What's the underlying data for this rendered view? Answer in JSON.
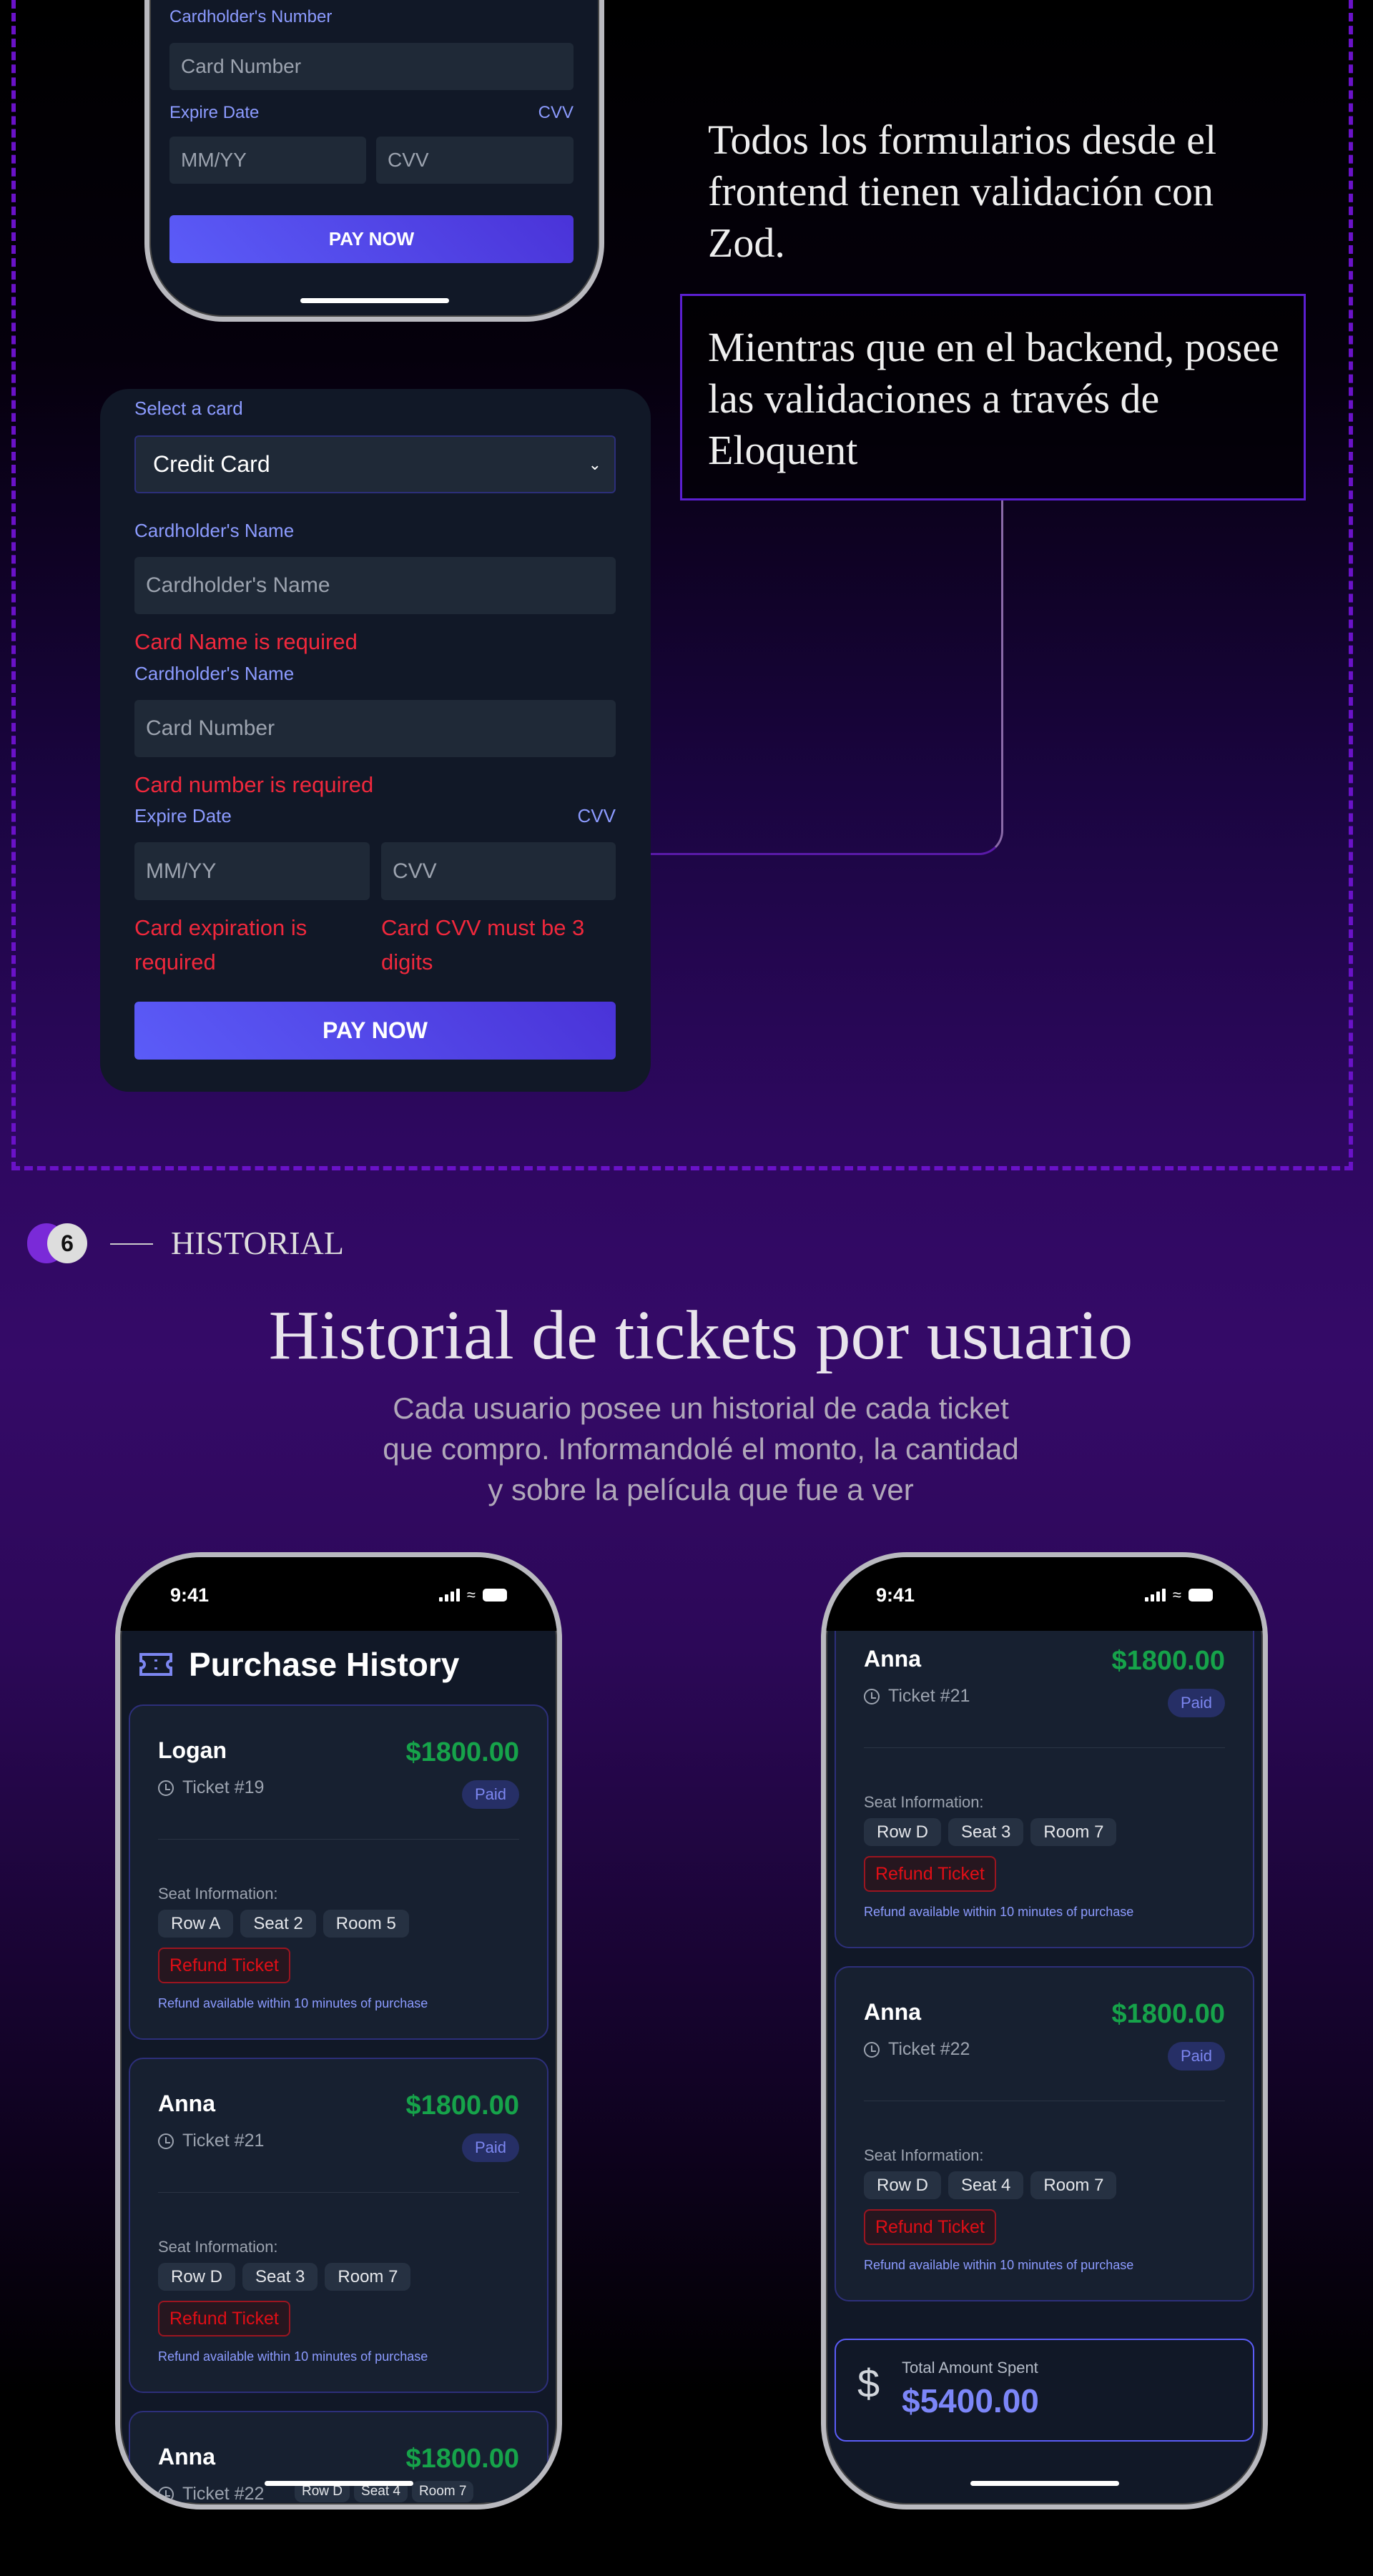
{
  "colors": {
    "accent": "#5b5cf8",
    "error": "#f0283c",
    "success": "#16a34a",
    "frame": "#6a12c8"
  },
  "top_form": {
    "card_number_label": "Cardholder's Number",
    "card_number_placeholder": "Card Number",
    "expire_label": "Expire Date",
    "cvv_label": "CVV",
    "expire_placeholder": "MM/YY",
    "cvv_placeholder": "CVV",
    "pay_label": "PAY NOW"
  },
  "notes": {
    "frontend": "Todos los formularios desde el frontend tienen validación con Zod.",
    "backend": "Mientras que en el backend, posee las validaciones a través de Eloquent"
  },
  "validation_form": {
    "select_label": "Select a card",
    "select_value": "Credit Card",
    "name_label": "Cardholder's Name",
    "name_placeholder": "Cardholder's Name",
    "name_error": "Card Name is required",
    "number_label": "Cardholder's Name",
    "number_placeholder": "Card Number",
    "number_error": "Card number is required",
    "expire_label": "Expire Date",
    "cvv_label": "CVV",
    "expire_placeholder": "MM/YY",
    "cvv_placeholder": "CVV",
    "expire_error": "Card expiration is required",
    "cvv_error": "Card CVV must be 3 digits",
    "pay_label": "PAY NOW"
  },
  "section": {
    "number": "6",
    "label": "HISTORIAL",
    "title": "Historial de tickets por usuario",
    "subtitle": [
      "Cada usuario posee un historial de cada ticket",
      "que compro. Informandolé el monto, la cantidad",
      "y sobre la película que fue a ver"
    ]
  },
  "status_bar": {
    "time": "9:41"
  },
  "history": {
    "title": "Purchase History",
    "seat_label": "Seat Information:",
    "refund_label": "Refund Ticket",
    "refund_note": "Refund available within 10 minutes of purchase",
    "status": "Paid",
    "left": [
      {
        "name": "Logan",
        "price": "$1800.00",
        "ticket": "Ticket #19",
        "seats": [
          "Row A",
          "Seat 2",
          "Room 5"
        ]
      },
      {
        "name": "Anna",
        "price": "$1800.00",
        "ticket": "Ticket #21",
        "seats": [
          "Row D",
          "Seat 3",
          "Room 7"
        ]
      },
      {
        "name": "Anna",
        "price": "$1800.00",
        "ticket": "Ticket #22",
        "seats": [
          "Row D",
          "Seat 4",
          "Room 7"
        ]
      }
    ],
    "right": [
      {
        "name": "Anna",
        "price": "$1800.00",
        "ticket": "Ticket #21",
        "seats": [
          "Row D",
          "Seat 3",
          "Room 7"
        ]
      },
      {
        "name": "Anna",
        "price": "$1800.00",
        "ticket": "Ticket #22",
        "seats": [
          "Row D",
          "Seat 4",
          "Room 7"
        ]
      }
    ],
    "total_label": "Total Amount Spent",
    "total_value": "$5400.00"
  }
}
